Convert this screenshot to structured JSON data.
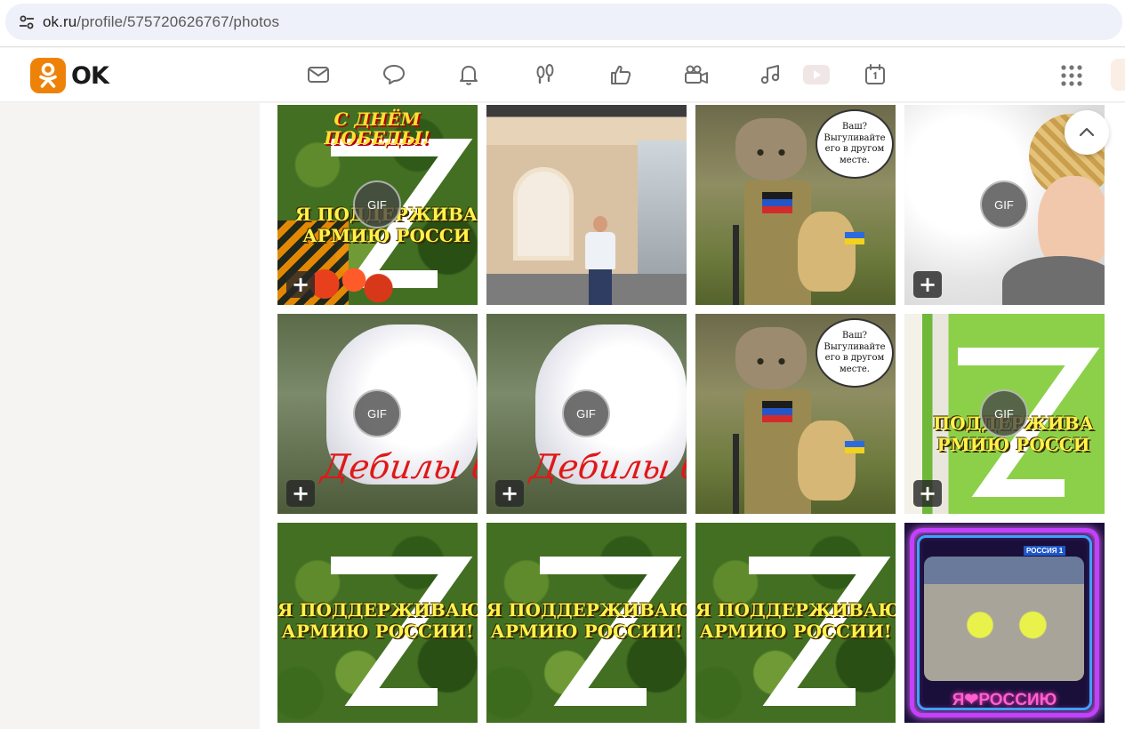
{
  "browser": {
    "url_host": "ok.ru",
    "url_path": "/profile/575720626767/photos"
  },
  "header": {
    "logo_text": "OK",
    "nav_icons": [
      "messages-icon",
      "discussions-icon",
      "notifications-icon",
      "guests-icon",
      "events-icon",
      "videos-icon",
      "music-icon",
      "video-play-icon",
      "calendar-icon"
    ],
    "apps_icon": "apps-grid-icon",
    "brand_color": "#ee8208"
  },
  "photos": {
    "gif_label": "GIF",
    "add_label": "+",
    "tiles": [
      {
        "kind": "victory-z",
        "gif": true,
        "plus": true,
        "top_text": "С ДНЁМ ПОБЕДЫ!",
        "line1": "Я ПОДДЕРЖИВА",
        "line2": "АРМИЮ РОССИ"
      },
      {
        "kind": "man-photo",
        "gif": false,
        "plus": false
      },
      {
        "kind": "cat-flag",
        "gif": false,
        "plus": false,
        "bubble": "Ваш? Выгуливайте его в другом месте."
      },
      {
        "kind": "cartoon-woman",
        "gif": true,
        "plus": true
      },
      {
        "kind": "white-cat",
        "gif": true,
        "plus": true,
        "red_text": "Дебилы бл"
      },
      {
        "kind": "white-cat",
        "gif": true,
        "plus": true,
        "red_text": "Дебилы бл"
      },
      {
        "kind": "cat-flag",
        "gif": false,
        "plus": false,
        "bubble": "Ваш? Выгуливайте его в другом месте."
      },
      {
        "kind": "birch-z",
        "gif": true,
        "plus": true,
        "line1": "ПОДДЕРЖИВА",
        "line2": "РМИЮ РОССИ"
      },
      {
        "kind": "camo-z",
        "gif": false,
        "plus": false,
        "line1": "Я ПОДДЕРЖИВАЮ",
        "line2": "АРМИЮ РОССИИ!"
      },
      {
        "kind": "camo-z",
        "gif": false,
        "plus": false,
        "line1": "Я ПОДДЕРЖИВАЮ",
        "line2": "АРМИЮ РОССИИ!"
      },
      {
        "kind": "camo-z",
        "gif": false,
        "plus": false,
        "line1": "Я ПОДДЕРЖИВАЮ",
        "line2": "АРМИЮ РОССИИ!"
      },
      {
        "kind": "neon-cat",
        "gif": false,
        "plus": false,
        "channel": "РОССИЯ 1",
        "bottom_text": "Я❤РОССИЮ"
      }
    ]
  }
}
